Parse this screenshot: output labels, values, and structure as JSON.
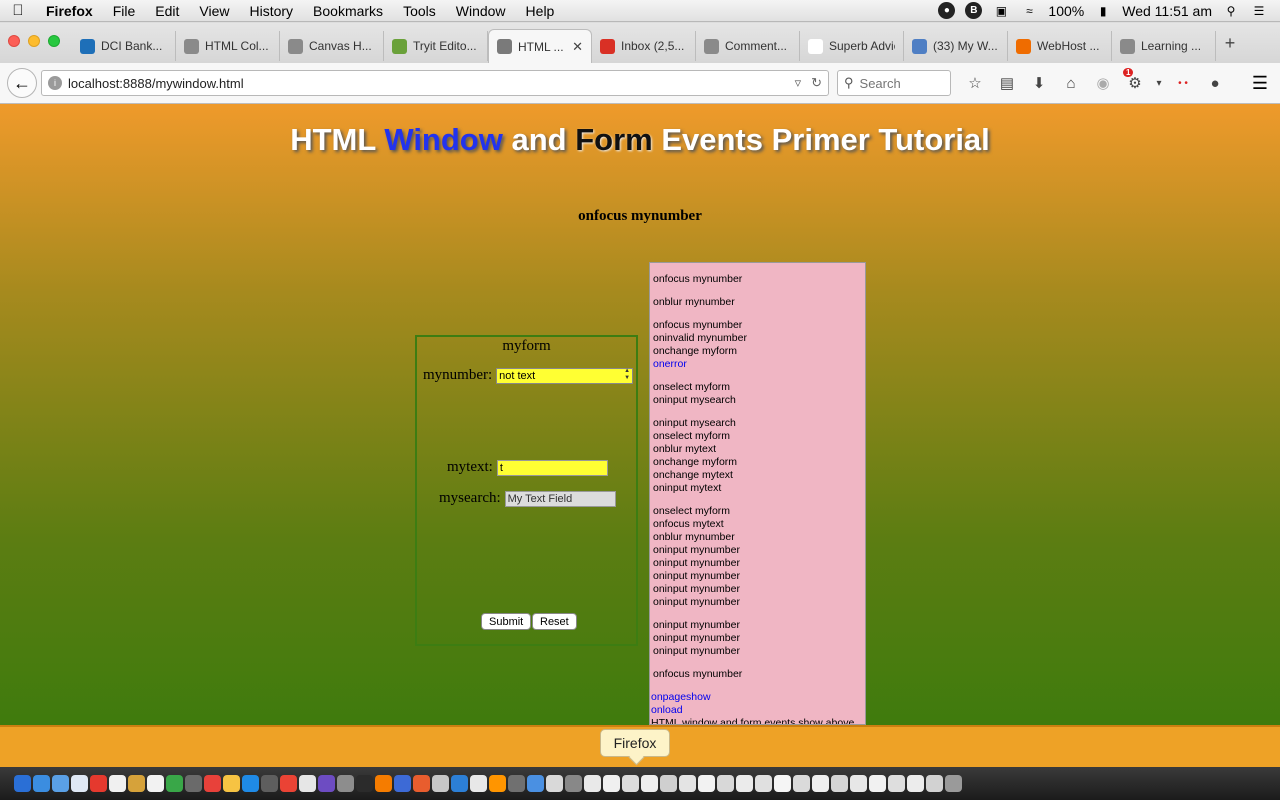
{
  "menubar": {
    "items": [
      "Firefox",
      "File",
      "Edit",
      "View",
      "History",
      "Bookmarks",
      "Tools",
      "Window",
      "Help"
    ],
    "battery": "100%",
    "clock": "Wed 11:51 am"
  },
  "tabs": [
    {
      "label": "DCI Bank...",
      "color": "#1e6fb8"
    },
    {
      "label": "HTML Col...",
      "color": "#8a8a8a"
    },
    {
      "label": "Canvas H...",
      "color": "#8a8a8a"
    },
    {
      "label": "Tryit Edito...",
      "color": "#6aa13a"
    },
    {
      "label": "HTML ...",
      "color": "#7a7a7a",
      "active": true
    },
    {
      "label": "Inbox (2,5...",
      "color": "#d93025"
    },
    {
      "label": "Comment...",
      "color": "#8a8a8a"
    },
    {
      "label": "Superb Advice...",
      "color": "#ffffff"
    },
    {
      "label": "(33) My W...",
      "color": "#4f7fc4"
    },
    {
      "label": "WebHost ...",
      "color": "#ef6c00"
    },
    {
      "label": "Learning ...",
      "color": "#8a8a8a"
    }
  ],
  "navbar": {
    "url": "localhost:8888/mywindow.html",
    "search_placeholder": "Search",
    "notification_count": "1"
  },
  "page": {
    "heading_part1": "HTML ",
    "heading_window": "Window",
    "heading_and": " and ",
    "heading_form": "Form",
    "heading_rest": " Events Primer Tutorial",
    "status": "onfocus mynumber"
  },
  "form": {
    "legend": "myform",
    "mynumber_label": "mynumber:",
    "mynumber_value": "not text",
    "mytext_label": "mytext:",
    "mytext_value": "t",
    "mysearch_label": "mysearch:",
    "mysearch_value": "My Text Field",
    "submit_label": "Submit",
    "reset_label": "Reset"
  },
  "log": [
    {
      "text": "onfocus mynumber"
    },
    {
      "gap": true
    },
    {
      "text": "onblur mynumber"
    },
    {
      "gap": true
    },
    {
      "text": "onfocus mynumber"
    },
    {
      "text": "oninvalid mynumber"
    },
    {
      "text": "onchange myform"
    },
    {
      "text": "onerror",
      "blue": true
    },
    {
      "gap": true
    },
    {
      "text": "onselect myform"
    },
    {
      "text": "oninput mysearch"
    },
    {
      "gap": true
    },
    {
      "text": "oninput mysearch"
    },
    {
      "text": "onselect myform"
    },
    {
      "text": "onblur mytext"
    },
    {
      "text": "onchange myform"
    },
    {
      "text": "onchange mytext"
    },
    {
      "text": "oninput mytext"
    },
    {
      "gap": true
    },
    {
      "text": "onselect myform"
    },
    {
      "text": "onfocus mytext"
    },
    {
      "text": "onblur mynumber"
    },
    {
      "text": "oninput mynumber"
    },
    {
      "text": "oninput mynumber"
    },
    {
      "text": "oninput mynumber"
    },
    {
      "text": "oninput mynumber"
    },
    {
      "text": "oninput mynumber"
    },
    {
      "gap": true
    },
    {
      "text": "oninput mynumber"
    },
    {
      "text": "oninput mynumber"
    },
    {
      "text": "oninput mynumber"
    },
    {
      "gap": true
    },
    {
      "text": "onfocus mynumber"
    },
    {
      "gap": true
    },
    {
      "text": "onpageshow",
      "blue": true,
      "outdent": true
    },
    {
      "text": "onload",
      "blue": true,
      "outdent": true
    },
    {
      "text": "HTML window and form events show above",
      "outdent": true
    }
  ],
  "dock": {
    "tooltip": "Firefox"
  }
}
